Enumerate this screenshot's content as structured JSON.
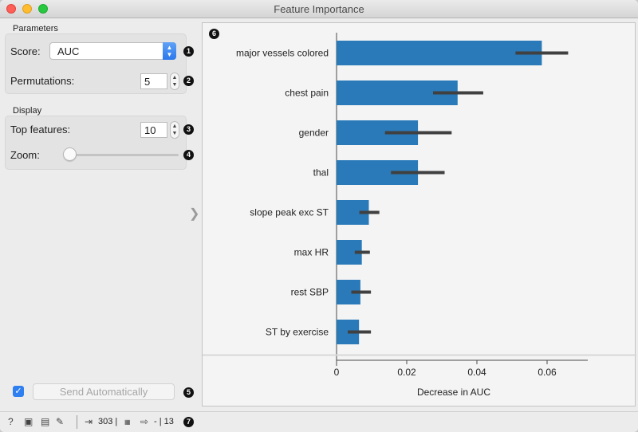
{
  "window": {
    "title": "Feature Importance"
  },
  "parameters": {
    "section_label": "Parameters",
    "score_label": "Score:",
    "score_value": "AUC",
    "permutations_label": "Permutations:",
    "permutations_value": "5"
  },
  "display": {
    "section_label": "Display",
    "top_features_label": "Top features:",
    "top_features_value": "10",
    "zoom_label": "Zoom:",
    "zoom_level": 0.0
  },
  "footer": {
    "send_automatically_label": "Send Automatically",
    "send_automatically_checked": true
  },
  "markers": [
    "1",
    "2",
    "3",
    "4",
    "5",
    "6",
    "7"
  ],
  "status_bar": {
    "input_count": "303 |",
    "output_text": "- | 13"
  },
  "chart_data": {
    "type": "bar",
    "orientation": "horizontal",
    "categories": [
      "major vessels colored",
      "chest pain",
      "gender",
      "thal",
      "slope peak exc ST",
      "max HR",
      "rest SBP",
      "ST by exercise"
    ],
    "values": [
      0.0585,
      0.0345,
      0.0232,
      0.0232,
      0.0092,
      0.0072,
      0.0068,
      0.0064
    ],
    "error_low": [
      0.051,
      0.0275,
      0.0138,
      0.0155,
      0.0065,
      0.0052,
      0.0042,
      0.0032
    ],
    "error_high": [
      0.066,
      0.0418,
      0.0328,
      0.0308,
      0.0122,
      0.0095,
      0.0098,
      0.0098
    ],
    "xlabel": "Decrease in AUC",
    "xticks": [
      0,
      0.02,
      0.04,
      0.06
    ],
    "xtick_labels": [
      "0",
      "0.02",
      "0.04",
      "0.06"
    ],
    "xlim": [
      0,
      0.07
    ],
    "bar_color": "#2a7ab9",
    "error_color": "#404040"
  }
}
